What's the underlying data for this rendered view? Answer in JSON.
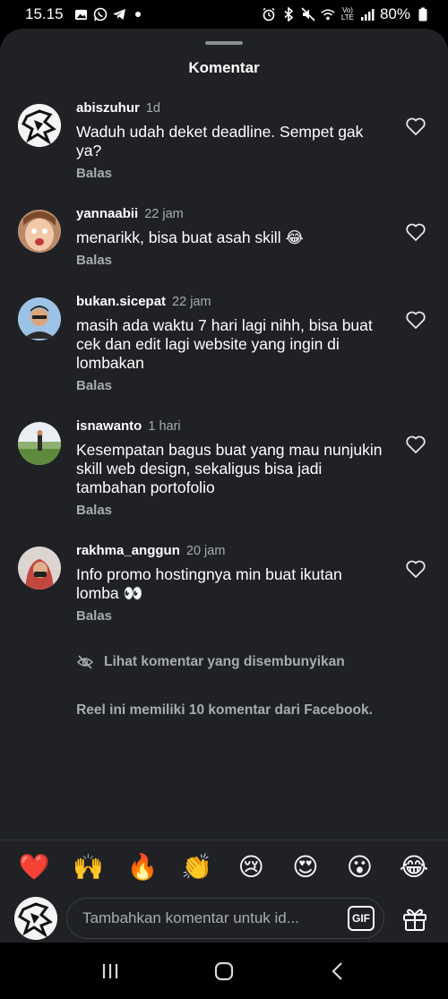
{
  "status_bar": {
    "time": "15.15",
    "left_icons": [
      "gallery-icon",
      "whatsapp-icon",
      "telegram-icon",
      "dot-icon"
    ],
    "right_icons": [
      "alarm-icon",
      "bluetooth-icon",
      "mute-icon",
      "wifi-icon",
      "volte-icon",
      "signal-icon"
    ],
    "volte_label": "Vo) LTE",
    "battery": "80%"
  },
  "sheet": {
    "title": "Komentar"
  },
  "comments": [
    {
      "user": "abiszuhur",
      "time": "1d",
      "text": "Waduh udah deket deadline. Sempet gak ya?",
      "reply": "Balas",
      "avatar": "avatar-abiszuhur"
    },
    {
      "user": "yannaabii",
      "time": "22 jam",
      "text": "menarikk, bisa buat asah skill 😂",
      "reply": "Balas",
      "avatar": "avatar-yannaabii"
    },
    {
      "user": "bukan.sicepat",
      "time": "22 jam",
      "text": "masih ada waktu 7 hari lagi nihh, bisa buat cek dan edit lagi website yang ingin di lombakan",
      "reply": "Balas",
      "avatar": "avatar-bukan-sicepat"
    },
    {
      "user": "isnawanto",
      "time": "1 hari",
      "text": "Kesempatan bagus buat yang mau nunjukin skill web design, sekaligus bisa jadi tambahan portofolio",
      "reply": "Balas",
      "avatar": "avatar-isnawanto"
    },
    {
      "user": "rakhma_anggun",
      "time": "20 jam",
      "text": "Info promo hostingnya min buat ikutan lomba 👀",
      "reply": "Balas",
      "avatar": "avatar-rakhma-anggun"
    }
  ],
  "hidden_comments_link": "Lihat komentar yang disembunyikan",
  "facebook_note": "Reel ini memiliki 10 komentar dari Facebook.",
  "quick_reactions": [
    "❤️",
    "🙌",
    "🔥",
    "👏",
    "😢",
    "😍",
    "😮",
    "😂"
  ],
  "composer": {
    "placeholder": "Tambahkan komentar untuk id...",
    "gif_label": "GIF"
  },
  "colors": {
    "sheet_bg": "#1f2125",
    "muted_text": "#a8abb0",
    "text": "#ffffff"
  }
}
